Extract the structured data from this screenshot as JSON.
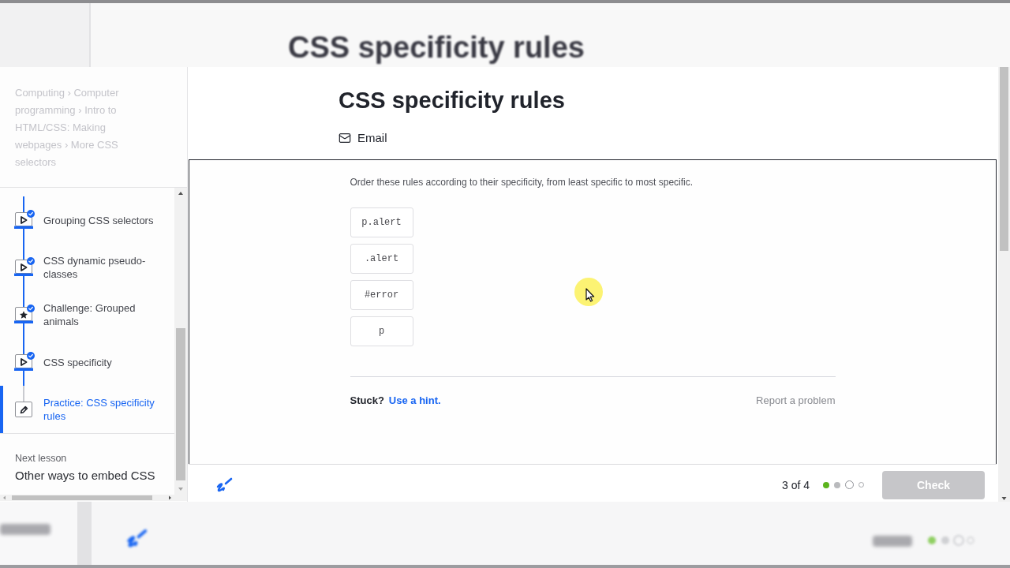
{
  "backdrop": {
    "title": "CSS specificity rules"
  },
  "sidebar": {
    "breadcrumb": "Computing › Computer programming › Intro to HTML/CSS: Making webpages › More CSS selectors",
    "items": [
      {
        "kind": "video",
        "label": "Grouping CSS selectors",
        "completed": true,
        "selected": false
      },
      {
        "kind": "video",
        "label": "CSS dynamic pseudo-classes",
        "completed": true,
        "selected": false
      },
      {
        "kind": "challenge",
        "label": "Challenge: Grouped animals",
        "completed": true,
        "selected": false
      },
      {
        "kind": "video",
        "label": "CSS specificity",
        "completed": true,
        "selected": false
      },
      {
        "kind": "exercise",
        "label": "Practice: CSS specificity rules",
        "completed": false,
        "selected": true
      }
    ],
    "next_lesson": {
      "heading": "Next lesson",
      "title": "Other ways to embed CSS"
    }
  },
  "header": {
    "title": "CSS specificity rules",
    "email_link": "Email"
  },
  "exercise": {
    "instruction": "Order these rules according to their specificity, from least specific to most specific.",
    "cards": [
      "p.alert",
      ".alert",
      "#error",
      "p"
    ],
    "stuck_label": "Stuck?",
    "hint_link": "Use a hint.",
    "report_link": "Report a problem"
  },
  "footer": {
    "progress_label": "3 of 4",
    "steps": [
      {
        "kind": "correct"
      },
      {
        "kind": "attempted"
      },
      {
        "kind": "current"
      },
      {
        "kind": "upcoming"
      }
    ],
    "check_button": {
      "label": "Check",
      "disabled": true
    }
  }
}
